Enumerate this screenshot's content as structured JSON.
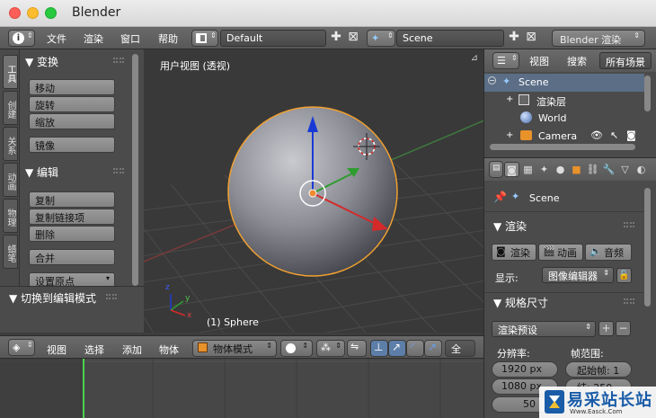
{
  "window": {
    "title": "Blender"
  },
  "info_header": {
    "menus": [
      "文件",
      "渲染",
      "窗口",
      "帮助"
    ],
    "layout": "Default",
    "scene": "Scene",
    "engine": "Blender 渲染"
  },
  "tool_tabs": [
    "工具",
    "创建",
    "关系",
    "动画",
    "物理",
    "蜡笔"
  ],
  "tool_shelf": {
    "transform": {
      "title": "▼ 变换",
      "buttons": [
        "移动",
        "旋转",
        "缩放",
        "镜像"
      ]
    },
    "edit": {
      "title": "▼ 编辑",
      "buttons": [
        "复制",
        "复制链接项",
        "删除",
        "合并",
        "设置原点"
      ]
    }
  },
  "operator_panel": {
    "title": "▼ 切换到编辑模式"
  },
  "viewport": {
    "label": "用户视图 (透视)",
    "object_label": "(1) Sphere",
    "axis_x": "x",
    "axis_y": "y",
    "axis_z": "z"
  },
  "viewport_header": {
    "menus": [
      "视图",
      "选择",
      "添加",
      "物体"
    ],
    "mode": "物体模式",
    "pivot": "全局"
  },
  "outliner_header": {
    "view": "视图",
    "search": "搜索",
    "filter": "所有场景"
  },
  "outliner": {
    "rows": [
      {
        "label": "Scene"
      },
      {
        "label": "渲染层"
      },
      {
        "label": "World"
      },
      {
        "label": "Camera"
      }
    ]
  },
  "properties": {
    "context": "Scene",
    "render_panel": "▼ 渲染",
    "render_btn": "渲染",
    "anim_btn": "动画",
    "audio_btn": "音频",
    "display_label": "显示:",
    "display_value": "图像编辑器",
    "dimensions_panel": "▼ 规格尺寸",
    "presets": "渲染预设",
    "resolution_label": "分辨率:",
    "frame_range_label": "帧范围:",
    "res_x": "1920 px",
    "res_y": "1080 px",
    "res_pct": "50",
    "start_frame": "起始帧: 1",
    "end_frame": "结: 250"
  },
  "watermark": {
    "text": "易采站长站",
    "url": "Www.Easck.Com"
  },
  "colors": {
    "accent_select": "#5b6e86",
    "object_outline": "#f0a030",
    "axis_x": "#d42a2a",
    "axis_y": "#2f9c2f",
    "axis_z": "#1a3ad6",
    "timeline_cursor": "#4cd34c"
  }
}
